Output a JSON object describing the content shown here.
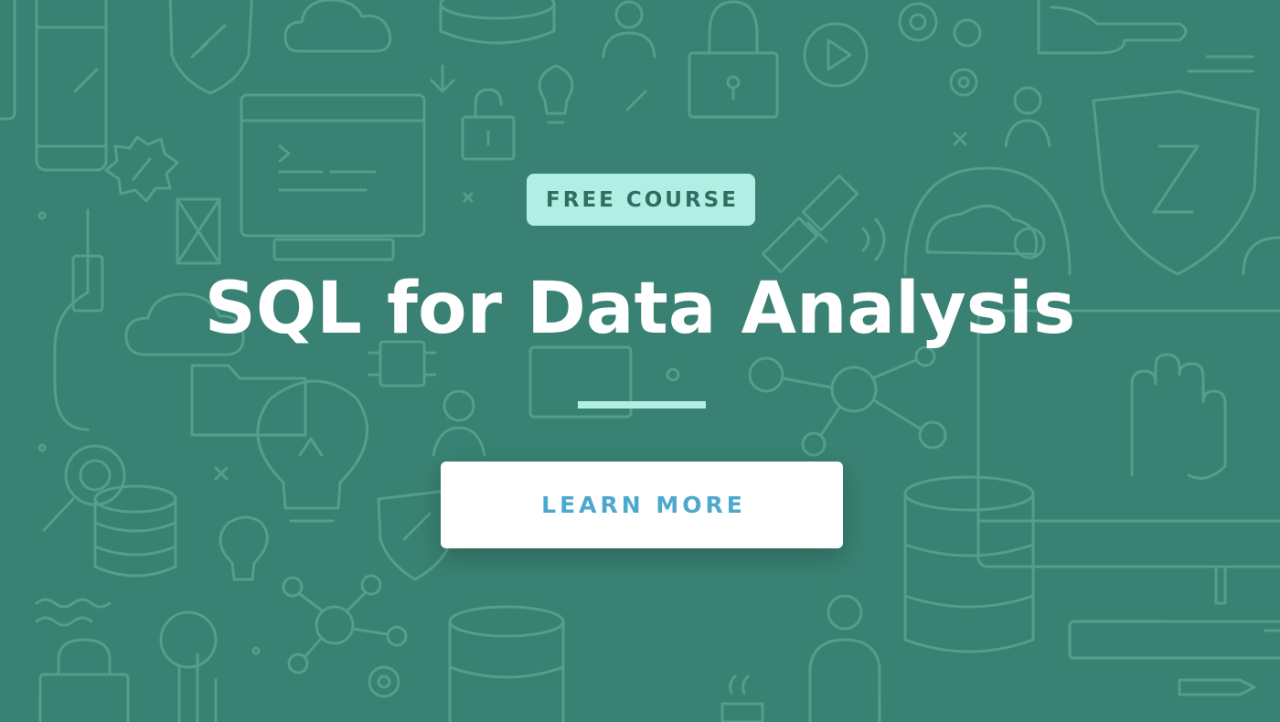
{
  "banner": {
    "badge_label": "FREE COURSE",
    "title": "SQL for Data Analysis",
    "cta_label": "LEARN MORE"
  },
  "theme": {
    "background": "#398273",
    "pattern": "#55a08f",
    "badge_bg": "#b1eee3",
    "badge_text": "#2f6e62",
    "title_text": "#ffffff",
    "divider": "#b1eee3",
    "button_bg": "#ffffff",
    "button_text": "#4da8cd"
  },
  "pattern_icons": [
    "phone-icon",
    "shield-icon",
    "cloud-icon",
    "database-icon",
    "user-icon",
    "lock-icon",
    "hand-pointer-icon",
    "gear-icon",
    "play-icon",
    "monitor-icon",
    "envelope-icon",
    "download-icon",
    "lightbulb-icon",
    "satellite-icon",
    "brain-icon",
    "magnifier-icon",
    "network-icon",
    "folder-icon",
    "chip-icon",
    "hand-icon",
    "pencil-icon",
    "globe-icon",
    "coffee-icon"
  ]
}
